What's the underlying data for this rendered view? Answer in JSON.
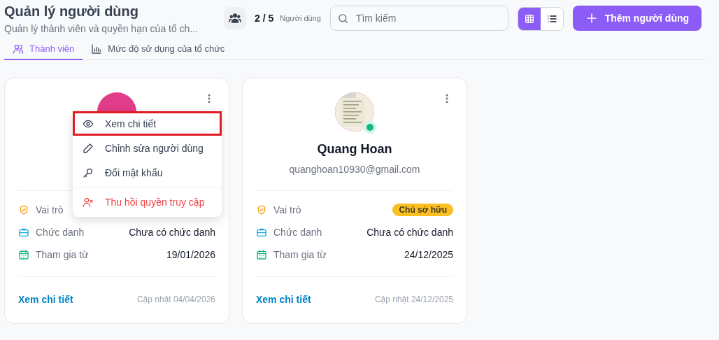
{
  "header": {
    "title": "Quản lý người dùng",
    "subtitle": "Quản lý thành viên và quyền hạn của tổ ch...",
    "count": "2 / 5",
    "count_label": "Người dùng",
    "search": {
      "placeholder": "Tìm kiếm"
    },
    "views": [
      {
        "kind": "grid",
        "selected": true
      },
      {
        "kind": "list",
        "selected": false
      }
    ],
    "add_button": "Thêm người dùng"
  },
  "tabs": [
    {
      "kind": "members",
      "label": "Thành viên",
      "selected": true
    },
    {
      "kind": "usage",
      "label": "Mức độ sử dụng của tổ chức",
      "selected": false
    }
  ],
  "cards": [
    {
      "avatar": {
        "kind": "initial"
      },
      "rows": [
        {
          "kind": "role",
          "label": "Vai trò"
        },
        {
          "kind": "title",
          "label": "Chức danh",
          "value": "Chưa có chức danh"
        },
        {
          "kind": "joined",
          "label": "Tham gia từ",
          "value": "19/01/2026"
        }
      ],
      "link": "Xem chi tiết",
      "updated": "Cập nhật 04/04/2026",
      "menu": [
        {
          "kind": "view",
          "label": "Xem chi tiết",
          "highlighted": true
        },
        {
          "kind": "edit",
          "label": "Chỉnh sửa người dùng",
          "highlighted": false
        },
        {
          "kind": "password",
          "label": "Đổi mật khẩu",
          "highlighted": false
        },
        {
          "kind": "revoke",
          "label": "Thu hồi quyền truy cập",
          "highlighted": false
        }
      ]
    },
    {
      "avatar": {
        "kind": "picture",
        "online": true
      },
      "name": "Quang Hoan",
      "email": "quanghoan10930@gmail.com",
      "rows": [
        {
          "kind": "role",
          "label": "Vai trò",
          "badge": "Chủ sở hữu",
          "color": "#fbbf24"
        },
        {
          "kind": "title",
          "label": "Chức danh",
          "value": "Chưa có chức danh"
        },
        {
          "kind": "joined",
          "label": "Tham gia từ",
          "value": "24/12/2025"
        }
      ],
      "link": "Xem chi tiết",
      "updated": "Cập nhật 24/12/2025"
    }
  ]
}
